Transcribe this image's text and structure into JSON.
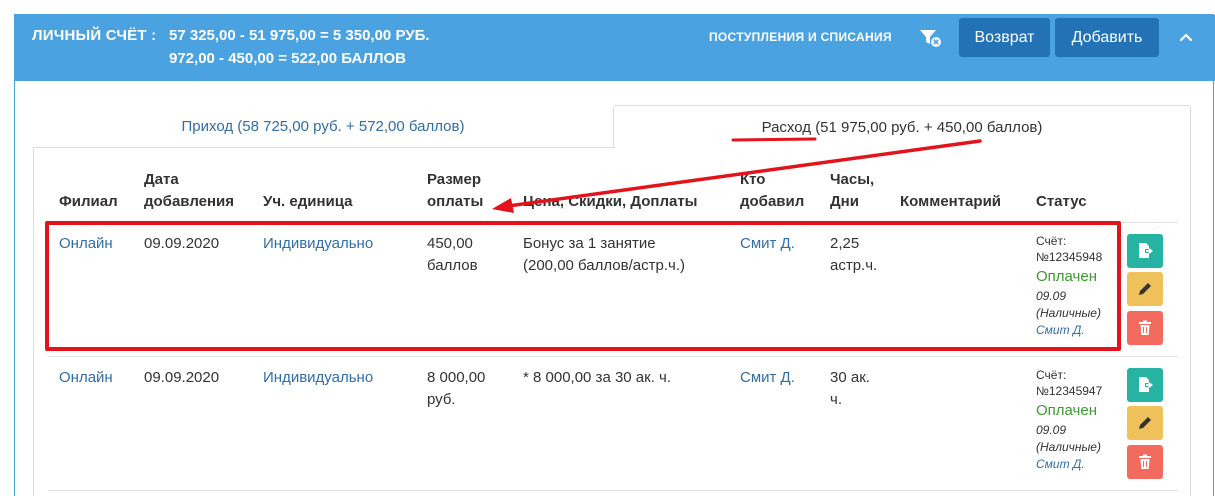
{
  "header": {
    "label": "ЛИЧНЫЙ СЧЁТ :",
    "line1": "57 325,00 - 51 975,00 = 5 350,00 РУБ.",
    "line2": "972,00 - 450,00 = 522,00 БАЛЛОВ",
    "link": "ПОСТУПЛЕНИЯ И СПИСАНИЯ",
    "return_label": "Возврат",
    "add_label": "Добавить",
    "icons": [
      "filter-icon",
      "chevron-up-icon"
    ]
  },
  "tabs": {
    "income": "Приход (58 725,00 руб. + 572,00 баллов)",
    "expense": "Расход (51 975,00 руб. + 450,00 баллов)"
  },
  "table": {
    "columns": {
      "branch": "Филиал",
      "date_1": "Дата",
      "date_2": "добавления",
      "unit": "Уч. единица",
      "size_1": "Размер",
      "size_2": "оплаты",
      "price": "Цена, Скидки, Доплаты",
      "who_1": "Кто",
      "who_2": "добавил",
      "hours_1": "Часы,",
      "hours_2": "Дни",
      "comment": "Комментарий",
      "status": "Статус"
    },
    "rows": [
      {
        "branch": "Онлайн",
        "date": "09.09.2020",
        "unit": "Индивидуально",
        "amount_1": "450,00",
        "amount_2": "баллов",
        "price_1": "Бонус за 1 занятие",
        "price_2": "(200,00 баллов/астр.ч.)",
        "who": "Смит Д.",
        "hours_1": "2,25",
        "hours_2": "астр.ч.",
        "comment": "",
        "invoice_label": "Счёт:",
        "invoice_no": "№12345948",
        "paid": "Оплачен",
        "paid_date": "09.09",
        "method": "(Наличные)",
        "paid_by": "Смит Д."
      },
      {
        "branch": "Онлайн",
        "date": "09.09.2020",
        "unit": "Индивидуально",
        "amount_1": "8 000,00",
        "amount_2": "руб.",
        "price_1": "* 8 000,00 за 30 ак. ч.",
        "price_2": "",
        "who": "Смит Д.",
        "hours_1": "30 ак.",
        "hours_2": "ч.",
        "comment": "",
        "invoice_label": "Счёт:",
        "invoice_no": "№12345947",
        "paid": "Оплачен",
        "paid_date": "09.09",
        "method": "(Наличные)",
        "paid_by": "Смит Д."
      }
    ],
    "row_icons": [
      "export-icon",
      "pencil-icon",
      "trash-icon"
    ]
  },
  "colors": {
    "header_bg": "#4aa3e0",
    "button_bg": "#2272b5",
    "link": "#2f6ea6",
    "paid": "#3c9a2e",
    "export_btn": "#26b3a2",
    "edit_btn": "#eec15a",
    "delete_btn": "#f36b5f",
    "annotation": "#e3121b"
  }
}
